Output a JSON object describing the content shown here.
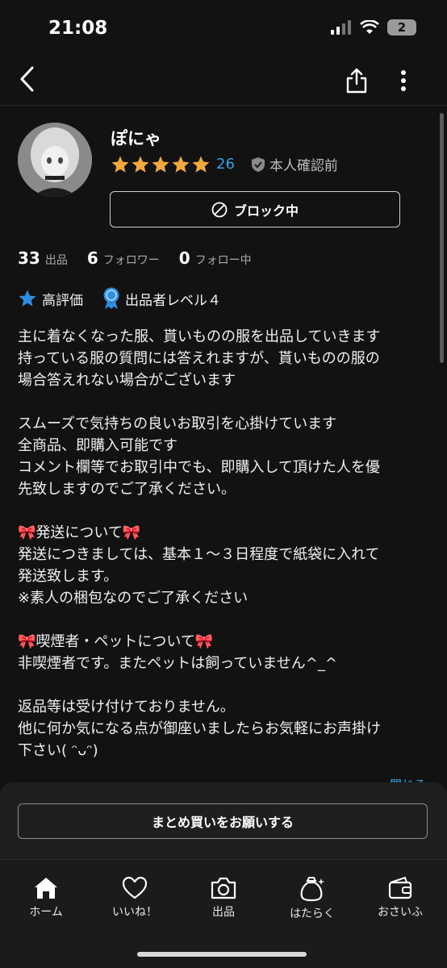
{
  "status_bar": {
    "time": "21:08",
    "battery": "2"
  },
  "profile": {
    "name": "ぽにゃ",
    "rating_count": "26",
    "verify_status": "本人確認前",
    "block_label": "ブロック中",
    "stats": [
      {
        "num": "33",
        "label": "出品"
      },
      {
        "num": "6",
        "label": "フォロワー"
      },
      {
        "num": "0",
        "label": "フォロー中"
      }
    ],
    "badges": [
      {
        "label": "高評価",
        "icon": "star-badge-icon"
      },
      {
        "label": "出品者レベル４",
        "icon": "medal-icon"
      }
    ],
    "stars": 5,
    "bio": "主に着なくなった服、貰いものの服を出品していきます\n持っている服の質問には答えれますが、貰いものの服の\n場合答えれない場合がございます\n\nスムーズで気持ちの良いお取引を心掛けています\n全商品、即購入可能です\nコメント欄等でお取引中でも、即購入して頂けた人を優\n先致しますのでご了承ください。\n\n🎀発送について🎀\n発送につきましては、基本１〜３日程度で紙袋に入れて\n発送致します。\n※素人の梱包なのでご了承ください\n\n🎀喫煙者・ペットについて🎀\n非喫煙者です。またペットは飼っていません^_^\n\n返品等は受け付けておりません。\n他に何か気になる点が御座いましたらお気軽にお声掛け\n下さい( ᵔᴗᵔ)",
    "close_label": "閉じる"
  },
  "bulk_button": "まとめ買いをお願いする",
  "tabs": [
    {
      "label": "ホーム",
      "icon": "home-icon"
    },
    {
      "label": "いいね！",
      "icon": "heart-icon"
    },
    {
      "label": "出品",
      "icon": "camera-icon"
    },
    {
      "label": "はたらく",
      "icon": "money-bag-icon"
    },
    {
      "label": "おさいふ",
      "icon": "wallet-icon"
    }
  ],
  "colors": {
    "accent_blue": "#3aa0e6",
    "star_gold": "#f2a93b",
    "background": "#121212"
  }
}
